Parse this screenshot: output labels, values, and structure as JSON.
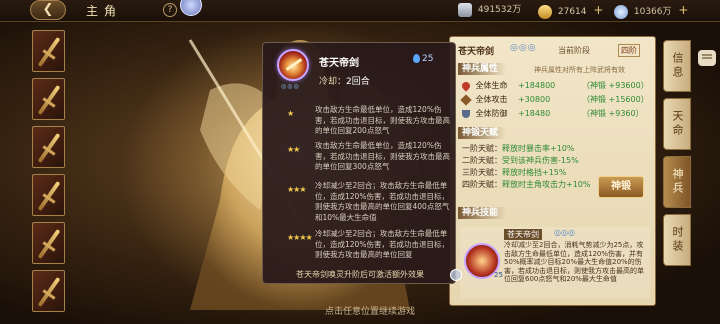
{
  "header": {
    "back_icon": "back-arrow-icon",
    "title": "主角",
    "help_label": "?",
    "resources": [
      {
        "value": "491532万",
        "icon": "silver-icon"
      },
      {
        "value": "27614",
        "icon": "gold-ingot-icon"
      },
      {
        "value": "10366万",
        "icon": "spirit-icon"
      }
    ],
    "plus_label": "+"
  },
  "tooltip": {
    "title": "苍天帝剑",
    "mana": "25",
    "cooldown_label": "冷却：",
    "cooldown_value": "2回合",
    "levels": [
      {
        "stars": "★",
        "text": "攻击敌方生命最低单位，造成120%伤害，若成功击退目标，则使我方攻击最高的单位回复200点怒气"
      },
      {
        "stars": "★★",
        "text": "攻击敌方生命最低单位，造成120%伤害，若成功击退目标，则使我方攻击最高的单位回复300点怒气"
      },
      {
        "stars": "★★★",
        "text": "冷却减少至2回合；攻击敌方生命最低单位，造成120%伤害，若成功击退目标，则使我方攻击最高的单位回复400点怒气和10%最大生命值"
      },
      {
        "stars": "★★★★",
        "text": "冷却减少至2回合；攻击敌方生命最低单位，造成120%伤害，若成功击退目标，则使我方攻击最高的单位回复"
      }
    ],
    "footer": "苍天帝剑唤灵升阶后可激活额外效果"
  },
  "panel": {
    "name": "苍天帝剑",
    "stars": "◎◎◎",
    "current_label": "当前阶段",
    "current_value": "四阶",
    "attr_title": "神兵属性",
    "attr_note": "神兵属性对所有上阵武将有效",
    "stats": [
      {
        "label": "全体生命",
        "value": "+184800",
        "bonus": "（神锻 +93600）",
        "color": "#c0392b"
      },
      {
        "label": "全体攻击",
        "value": "+30800",
        "bonus": "（神锻 +15600）",
        "color": "#8a5a2b"
      },
      {
        "label": "全体防御",
        "value": "+18480",
        "bonus": "（神锻 +9360）",
        "color": "#5a6a8a"
      }
    ],
    "talent_title": "神锻天赋",
    "talents": [
      {
        "label": "一阶天赋：",
        "value": "释放时暴击率+10%"
      },
      {
        "label": "二阶天赋：",
        "value": "受到该神兵伤害-15%"
      },
      {
        "label": "三阶天赋：",
        "value": "释放时格挡+15%"
      },
      {
        "label": "四阶天赋：",
        "value": "释放时主角攻击力+10%"
      }
    ],
    "forge_button": "神锻",
    "skill_title": "神兵技能",
    "skill": {
      "name": "苍天帝剑",
      "stars": "◎◎◎",
      "badge": "25",
      "desc": "冷却减少至2回合，消耗气势减少为25点，攻击敌方生命最低单位，造成120%伤害，并有50%概率减少目标20%最大生命值20%的伤害，若成功击退目标，则使我方攻击最高的单位回复600点怒气和20%最大生命值"
    }
  },
  "tabs": [
    {
      "label": "信息",
      "active": false
    },
    {
      "label": "天命",
      "active": false
    },
    {
      "label": "神兵",
      "active": true
    },
    {
      "label": "时装",
      "active": false
    }
  ],
  "bottom_hint": "点击任意位置继续游戏",
  "colors": {
    "accent": "#f2c94c",
    "mana": "#5aa8ff",
    "positive": "#2f8a36"
  }
}
